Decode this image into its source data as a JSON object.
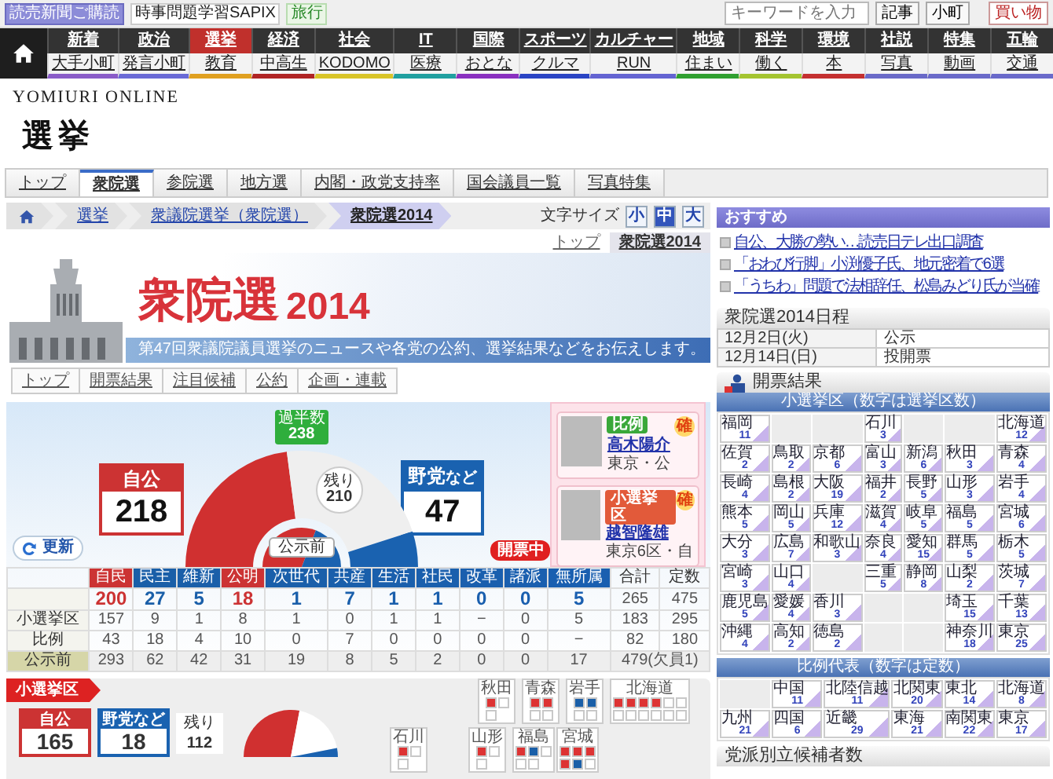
{
  "topbar": {
    "links": [
      {
        "label": "読売新聞ご購読",
        "kind": "badge"
      },
      {
        "label": "時事問題学習SAPIX",
        "kind": "plain"
      },
      {
        "label": "旅行",
        "kind": "green"
      }
    ],
    "search": {
      "placeholder": "キーワードを入力"
    },
    "search_buttons": [
      "記事",
      "小町"
    ],
    "shop_button": "買い物"
  },
  "nav": {
    "primary": [
      {
        "label": "新着",
        "selected": false
      },
      {
        "label": "政治",
        "selected": false
      },
      {
        "label": "選挙",
        "selected": true
      },
      {
        "label": "経済",
        "selected": false
      },
      {
        "label": "社会",
        "selected": false
      },
      {
        "label": "IT",
        "selected": false
      },
      {
        "label": "国際",
        "selected": false
      },
      {
        "label": "スポーツ",
        "selected": false
      },
      {
        "label": "カルチャー",
        "selected": false
      },
      {
        "label": "地域",
        "selected": false
      },
      {
        "label": "科学",
        "selected": false
      },
      {
        "label": "環境",
        "selected": false
      },
      {
        "label": "社説",
        "selected": false
      },
      {
        "label": "特集",
        "selected": false
      },
      {
        "label": "五輪",
        "selected": false
      }
    ],
    "secondary": [
      {
        "label": "大手小町",
        "color": "#8a5cc8"
      },
      {
        "label": "発言小町",
        "color": "#6a6ad6"
      },
      {
        "label": "教育",
        "color": "#e0a020"
      },
      {
        "label": "中高生",
        "color": "#b02424"
      },
      {
        "label": "KODOMO",
        "color": "#d8c428"
      },
      {
        "label": "医療",
        "color": "#20a0a0"
      },
      {
        "label": "おとな",
        "color": "#8a30c0"
      },
      {
        "label": "クルマ",
        "color": "#2a44c4"
      },
      {
        "label": "RUN",
        "color": "#6464d2"
      },
      {
        "label": "住まい",
        "color": "#30a030"
      },
      {
        "label": "働く",
        "color": "#a4c430"
      },
      {
        "label": "本",
        "color": "#c43030"
      },
      {
        "label": "写真",
        "color": "#6a6ac8"
      },
      {
        "label": "動画",
        "color": "#6a6ac9"
      },
      {
        "label": "交通",
        "color": "#6a6aca"
      }
    ]
  },
  "site_logo": "YOMIURI ONLINE",
  "page_title": "選挙",
  "section_tabs": [
    {
      "label": "トップ",
      "selected": false
    },
    {
      "label": "衆院選",
      "selected": true
    },
    {
      "label": "参院選",
      "selected": false
    },
    {
      "label": "地方選",
      "selected": false
    },
    {
      "label": "内閣・政党支持率",
      "selected": false
    },
    {
      "label": "国会議員一覧",
      "selected": false
    },
    {
      "label": "写真特集",
      "selected": false
    }
  ],
  "breadcrumb": [
    {
      "label": "選挙",
      "current": false
    },
    {
      "label": "衆議院選挙（衆院選）",
      "current": false
    },
    {
      "label": "衆院選2014",
      "current": true
    }
  ],
  "font_size": {
    "label": "文字サイズ",
    "options": [
      {
        "label": "小",
        "selected": false
      },
      {
        "label": "中",
        "selected": true
      },
      {
        "label": "大",
        "selected": false
      }
    ]
  },
  "sub_tabs": [
    {
      "label": "トップ",
      "selected": false
    },
    {
      "label": "衆院選2014",
      "selected": true
    }
  ],
  "banner": {
    "title": "衆院選",
    "year": "2014",
    "tagline": "第47回衆議院議員選挙のニュースや各党の公約、選挙結果などをお伝えします。"
  },
  "banner_tabs": [
    "トップ",
    "開票結果",
    "注目候補",
    "公約",
    "企画・連載"
  ],
  "results": {
    "majority_label": "過半数",
    "majority": "238",
    "ruling": {
      "label": "自公",
      "count": "218"
    },
    "opposition": {
      "label": "野党",
      "suffix": "など",
      "count": "47"
    },
    "remaining": {
      "label": "残り",
      "count": "210"
    },
    "before_label": "公示前",
    "refresh": "更新",
    "status": "開票中",
    "candidates": [
      {
        "kind": "pr",
        "tag": "比例",
        "name": "高木陽介",
        "area": "東京・公",
        "mark": "確"
      },
      {
        "kind": "district",
        "tag": "小選挙区",
        "name": "越智隆雄",
        "area": "東京6区・自",
        "mark": "確"
      }
    ],
    "table": {
      "columns": [
        {
          "label": "自民",
          "color": "#cc3333"
        },
        {
          "label": "民主",
          "color": "#1a5fa8"
        },
        {
          "label": "維新",
          "color": "#1a5fa9"
        },
        {
          "label": "公明",
          "color": "#cc3334"
        },
        {
          "label": "次世代",
          "color": "#1a5faa"
        },
        {
          "label": "共産",
          "color": "#1a5fab"
        },
        {
          "label": "生活",
          "color": "#1a5fac"
        },
        {
          "label": "社民",
          "color": "#1a5fad"
        },
        {
          "label": "改革",
          "color": "#1a5fae"
        },
        {
          "label": "諸派",
          "color": "#1a5faf"
        },
        {
          "label": "無所属",
          "color": "#1a5fb0"
        }
      ],
      "extra_columns": [
        "合計",
        "定数"
      ],
      "rows": [
        {
          "kind": "seats",
          "cells": [
            "200",
            "27",
            "5",
            "18",
            "1",
            "7",
            "1",
            "1",
            "0",
            "0",
            "5",
            "265",
            "475"
          ]
        },
        {
          "kind": "detail",
          "label": "小選挙区",
          "cells": [
            "157",
            "9",
            "1",
            "8",
            "1",
            "0",
            "1",
            "1",
            "−",
            "0",
            "5",
            "183",
            "295"
          ]
        },
        {
          "kind": "detail",
          "label": "比例",
          "cells": [
            "43",
            "18",
            "4",
            "10",
            "0",
            "7",
            "0",
            "0",
            "0",
            "0",
            "−",
            "82",
            "180"
          ]
        },
        {
          "kind": "before",
          "label": "公示前",
          "cells": [
            "293",
            "62",
            "42",
            "31",
            "19",
            "8",
            "5",
            "2",
            "0",
            "0",
            "17",
            {
              "text": "479(欠員1)",
              "colspan": 2
            }
          ]
        }
      ]
    }
  },
  "district_summary": {
    "title": "小選挙区",
    "ruling": {
      "label": "自公",
      "count": "165"
    },
    "opposition": {
      "label": "野党",
      "suffix": "など",
      "count": "18"
    },
    "remaining": {
      "label": "残り",
      "count": "112"
    },
    "prefectures": [
      {
        "name": "秋田",
        "seats": [
          {
            "color": "#dd3333"
          },
          {
            "color": "#ffffff"
          },
          {
            "color": "#ffffff"
          }
        ]
      },
      {
        "name": "青森",
        "seats": [
          {
            "color": "#dd3333"
          },
          {
            "color": "#dd3333"
          },
          {
            "color": "#ffffff"
          },
          {
            "color": "#ffffff"
          }
        ]
      },
      {
        "name": "岩手",
        "seats": [
          {
            "color": "#1a5fa8"
          },
          {
            "color": "#1a5fa8"
          },
          {
            "color": "#ffffff"
          },
          {
            "color": "#ffffff"
          }
        ]
      },
      {
        "name": "北海道",
        "seats": [
          {
            "color": "#dd3333"
          },
          {
            "color": "#dd3333"
          },
          {
            "color": "#dd3333"
          },
          {
            "color": "#dd3333"
          },
          {
            "color": "#ffffff"
          },
          {
            "color": "#ffffff"
          },
          {
            "color": "#ffffff"
          },
          {
            "color": "#ffffff"
          },
          {
            "color": "#ffffff"
          },
          {
            "color": "#ffffff"
          },
          {
            "color": "#ffffff"
          },
          {
            "color": "#ffffff"
          }
        ]
      },
      {
        "name": "石川",
        "seats": [
          {
            "color": "#dd3333"
          },
          {
            "color": "#ffffff"
          },
          {
            "color": "#ffffff"
          }
        ]
      },
      {
        "name": "山形",
        "seats": [
          {
            "color": "#dd3333"
          },
          {
            "color": "#ffffff"
          },
          {
            "color": "#ffffff"
          }
        ]
      },
      {
        "name": "福島",
        "seats": [
          {
            "color": "#dd3333"
          },
          {
            "color": "#1a5fa8"
          },
          {
            "color": "#ffffff"
          },
          {
            "color": "#ffffff"
          },
          {
            "color": "#ffffff"
          }
        ]
      },
      {
        "name": "宮城",
        "seats": [
          {
            "color": "#dd3333"
          },
          {
            "color": "#dd3333"
          },
          {
            "color": "#dd3333"
          },
          {
            "color": "#dd3333"
          },
          {
            "color": "#1a5fa8"
          },
          {
            "color": "#ffffff"
          }
        ]
      }
    ]
  },
  "sidebar": {
    "recommended": {
      "title": "おすすめ",
      "links": [
        "自公、大勝の勢い…読売日テレ出口調査",
        "「おわび行脚」小渕優子氏、地元密着で6選",
        "「うちわ」問題で法相辞任、松島みどり氏が当確"
      ]
    },
    "schedule": {
      "title": "衆院選2014日程",
      "rows": [
        {
          "date": "12月2日(火)",
          "event": "公示"
        },
        {
          "date": "12月14日(日)",
          "event": "投開票"
        }
      ]
    },
    "results": {
      "title": "開票結果",
      "district": {
        "title": "小選挙区（数字は選挙区数）",
        "rows": [
          [
            {
              "name": "福岡",
              "count": "11"
            },
            null,
            null,
            {
              "name": "石川",
              "count": "3"
            },
            null,
            null,
            {
              "name": "北海道",
              "count": "12"
            }
          ],
          [
            {
              "name": "佐賀",
              "count": "2"
            },
            {
              "name": "鳥取",
              "count": "2"
            },
            {
              "name": "京都",
              "count": "6"
            },
            {
              "name": "富山",
              "count": "3"
            },
            {
              "name": "新潟",
              "count": "6"
            },
            {
              "name": "秋田",
              "count": "3"
            },
            {
              "name": "青森",
              "count": "4"
            }
          ],
          [
            {
              "name": "長崎",
              "count": "4"
            },
            {
              "name": "島根",
              "count": "2"
            },
            {
              "name": "大阪",
              "count": "19"
            },
            {
              "name": "福井",
              "count": "2"
            },
            {
              "name": "長野",
              "count": "5"
            },
            {
              "name": "山形",
              "count": "3"
            },
            {
              "name": "岩手",
              "count": "4"
            }
          ],
          [
            {
              "name": "熊本",
              "count": "5"
            },
            {
              "name": "岡山",
              "count": "5"
            },
            {
              "name": "兵庫",
              "count": "12"
            },
            {
              "name": "滋賀",
              "count": "4"
            },
            {
              "name": "岐阜",
              "count": "5"
            },
            {
              "name": "福島",
              "count": "5"
            },
            {
              "name": "宮城",
              "count": "6"
            }
          ],
          [
            {
              "name": "大分",
              "count": "3"
            },
            {
              "name": "広島",
              "count": "7"
            },
            {
              "name": "和歌山",
              "count": "3"
            },
            {
              "name": "奈良",
              "count": "4"
            },
            {
              "name": "愛知",
              "count": "15"
            },
            {
              "name": "群馬",
              "count": "5"
            },
            {
              "name": "栃木",
              "count": "5"
            }
          ],
          [
            {
              "name": "宮崎",
              "count": "3"
            },
            {
              "name": "山口",
              "count": "4"
            },
            null,
            {
              "name": "三重",
              "count": "5"
            },
            {
              "name": "静岡",
              "count": "8"
            },
            {
              "name": "山梨",
              "count": "2"
            },
            {
              "name": "茨城",
              "count": "7"
            }
          ],
          [
            {
              "name": "鹿児島",
              "count": "5"
            },
            {
              "name": "愛媛",
              "count": "4"
            },
            {
              "name": "香川",
              "count": "3"
            },
            null,
            null,
            {
              "name": "埼玉",
              "count": "15"
            },
            {
              "name": "千葉",
              "count": "13"
            }
          ],
          [
            {
              "name": "沖縄",
              "count": "4"
            },
            {
              "name": "高知",
              "count": "2"
            },
            {
              "name": "徳島",
              "count": "2"
            },
            null,
            null,
            {
              "name": "神奈川",
              "count": "18"
            },
            {
              "name": "東京",
              "count": "25"
            }
          ]
        ]
      },
      "proportional": {
        "title": "比例代表（数字は定数）",
        "rows": [
          [
            null,
            {
              "name": "中国",
              "count": "11"
            },
            {
              "name": "北陸信越",
              "count": "11"
            },
            {
              "name": "北関東",
              "count": "20"
            },
            {
              "name": "東北",
              "count": "14"
            },
            {
              "name": "北海道",
              "count": "8"
            }
          ],
          [
            {
              "name": "九州",
              "count": "21"
            },
            {
              "name": "四国",
              "count": "6"
            },
            {
              "name": "近畿",
              "count": "29"
            },
            {
              "name": "東海",
              "count": "21"
            },
            {
              "name": "南関東",
              "count": "22"
            },
            {
              "name": "東京",
              "count": "17"
            }
          ]
        ]
      }
    },
    "candidates_title": "党派別立候補者数"
  }
}
